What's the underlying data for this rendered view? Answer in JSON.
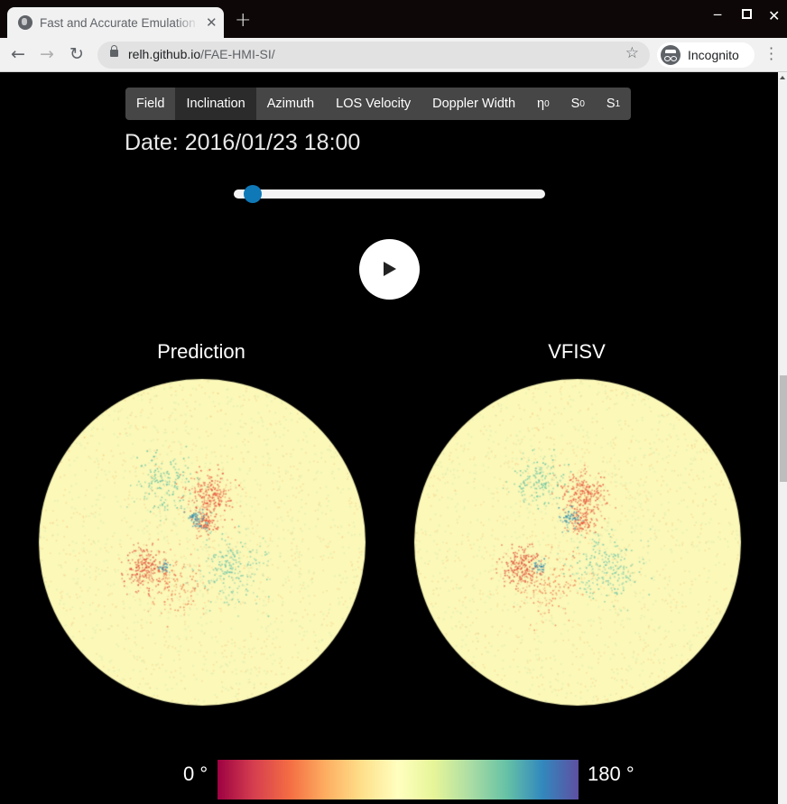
{
  "browser": {
    "tab_title": "Fast and Accurate Emulation of HMI-SI",
    "tab_icon": "globe-icon",
    "new_tab_label": "+",
    "url_host": "relh.github.io",
    "url_path": "/FAE-HMI-SI/",
    "incognito_label": "Incognito",
    "window_controls": [
      "minimize",
      "maximize",
      "close"
    ]
  },
  "page": {
    "tabs": [
      {
        "label": "Field",
        "sub": "",
        "active": false
      },
      {
        "label": "Inclination",
        "sub": "",
        "active": true
      },
      {
        "label": "Azimuth",
        "sub": "",
        "active": false
      },
      {
        "label": "LOS Velocity",
        "sub": "",
        "active": false
      },
      {
        "label": "Doppler Width",
        "sub": "",
        "active": false
      },
      {
        "label": "η",
        "sub": "0",
        "active": false
      },
      {
        "label": "S",
        "sub": "0",
        "active": false
      },
      {
        "label": "S",
        "sub": "1",
        "active": false
      }
    ],
    "date_label": "Date: 2016/01/23 18:00",
    "slider": {
      "value_fraction": 0.06
    },
    "play_button": "play-icon",
    "panels": [
      {
        "title": "Prediction"
      },
      {
        "title": "VFISV"
      }
    ],
    "colorbar": {
      "min_label": "0 °",
      "max_label": "180 °",
      "colormap": "Spectral",
      "stops": [
        "#9e0142",
        "#d53e4f",
        "#f46d43",
        "#fdae61",
        "#fee08b",
        "#ffffbf",
        "#e6f598",
        "#abdda4",
        "#66c2a5",
        "#3288bd",
        "#5e4fa2"
      ]
    },
    "disk_background": "#fbf8b8"
  }
}
